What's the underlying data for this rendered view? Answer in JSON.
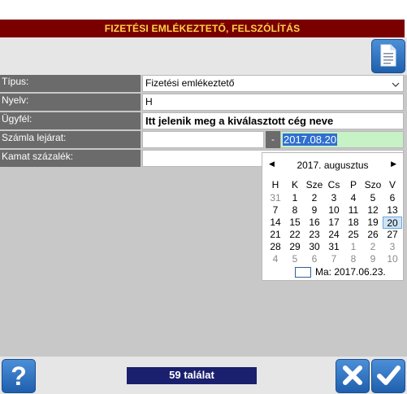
{
  "title": "FIZETÉSI EMLÉKEZTETŐ, FELSZÓLÍTÁS",
  "form": {
    "rows": [
      {
        "label": "Típus:",
        "value": "Fizetési emlékeztető"
      },
      {
        "label": "Nyelv:",
        "value": "H"
      },
      {
        "label": "Ügyfél:",
        "value": "Itt jelenik meg a kiválasztott cég neve"
      },
      {
        "label": "Számla lejárat:",
        "value": ""
      },
      {
        "label": "Kamat százalék:",
        "value": ""
      }
    ],
    "date_separator": "-",
    "due_date": "2017.08.20"
  },
  "calendar": {
    "month_title": "2017. augusztus",
    "weekdays": [
      "H",
      "K",
      "Sze",
      "Cs",
      "P",
      "Szo",
      "V"
    ],
    "weeks": [
      [
        "31",
        "1",
        "2",
        "3",
        "4",
        "5",
        "6"
      ],
      [
        "7",
        "8",
        "9",
        "10",
        "11",
        "12",
        "13"
      ],
      [
        "14",
        "15",
        "16",
        "17",
        "18",
        "19",
        "20"
      ],
      [
        "21",
        "22",
        "23",
        "24",
        "25",
        "26",
        "27"
      ],
      [
        "28",
        "29",
        "30",
        "31",
        "1",
        "2",
        "3"
      ],
      [
        "4",
        "5",
        "6",
        "7",
        "8",
        "9",
        "10"
      ]
    ],
    "today_label": "Ma: 2017.06.23."
  },
  "footer": {
    "result_count": "59 találat"
  },
  "colors": {
    "title_bg": "#7a0000",
    "title_text": "#ffd24a",
    "label_bg": "#6b6b6b",
    "date_bg": "#c6f2c6",
    "count_bg": "#1a1f6e",
    "button_blue": "#2f6fd0"
  },
  "icons": [
    "document-icon",
    "help-icon",
    "close-icon",
    "checkmark-icon",
    "chevron-down-icon",
    "chevron-left-icon",
    "chevron-right-icon"
  ]
}
